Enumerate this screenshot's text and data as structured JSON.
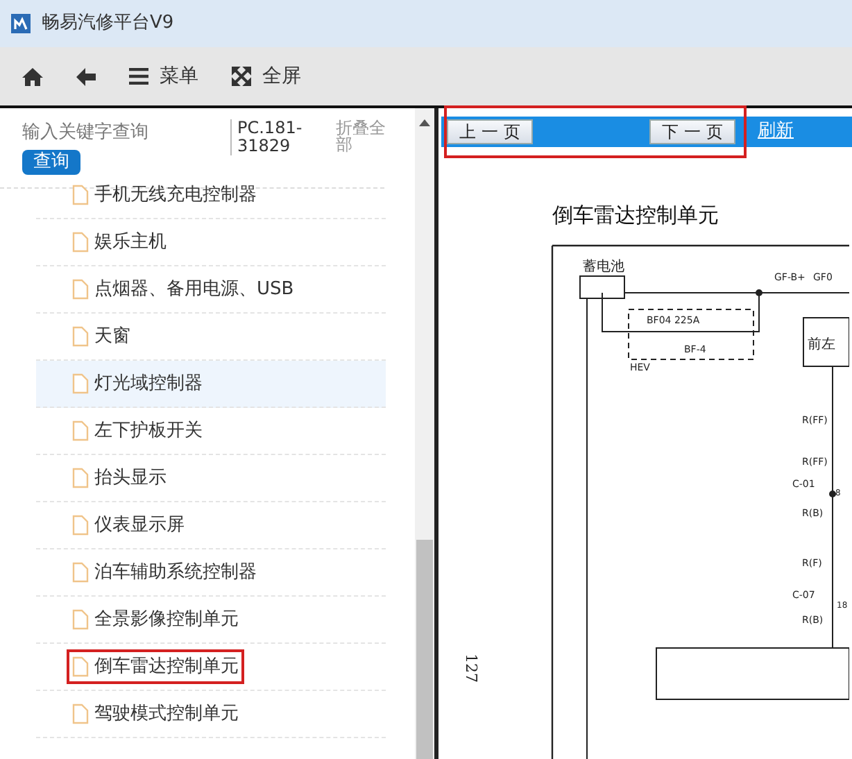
{
  "window": {
    "title": "畅易汽修平台V9"
  },
  "toolbar": [
    {
      "kind": "home"
    },
    {
      "kind": "back"
    },
    {
      "kind": "menu",
      "label": "菜单"
    },
    {
      "kind": "fullscreen",
      "label": "全屏"
    }
  ],
  "search": {
    "placeholder": "输入关键字查询",
    "button": "查询"
  },
  "doc_code": "PC.181-31829",
  "collapse_all": "折叠全部",
  "tree_items": [
    {
      "label": "手机无线充电控制器",
      "hovered": false,
      "highlighted": false
    },
    {
      "label": "娱乐主机",
      "hovered": false,
      "highlighted": false
    },
    {
      "label": "点烟器、备用电源、USB",
      "hovered": false,
      "highlighted": false
    },
    {
      "label": "天窗",
      "hovered": false,
      "highlighted": false
    },
    {
      "label": "灯光域控制器",
      "hovered": true,
      "highlighted": false
    },
    {
      "label": "左下护板开关",
      "hovered": false,
      "highlighted": false
    },
    {
      "label": "抬头显示",
      "hovered": false,
      "highlighted": false
    },
    {
      "label": "仪表显示屏",
      "hovered": false,
      "highlighted": false
    },
    {
      "label": "泊车辅助系统控制器",
      "hovered": false,
      "highlighted": false
    },
    {
      "label": "全景影像控制单元",
      "hovered": false,
      "highlighted": false
    },
    {
      "label": "倒车雷达控制单元",
      "hovered": false,
      "highlighted": true
    },
    {
      "label": "驾驶模式控制单元",
      "hovered": false,
      "highlighted": false
    }
  ],
  "pager": {
    "prev": "上 一 页",
    "next": "下 一 页",
    "refresh": "刷新",
    "highlighted": true
  },
  "document": {
    "title": "倒车雷达控制单元",
    "page_number": "127",
    "labels": [
      "蓄电池",
      "GF-B+",
      "GF0",
      "BF04 225A",
      "BF-4",
      "HEV",
      "前左",
      "R(FF)",
      "R(FF)",
      "C-01",
      "8",
      "R(B)",
      "R(F)",
      "C-07",
      "18",
      "R(B)"
    ]
  }
}
